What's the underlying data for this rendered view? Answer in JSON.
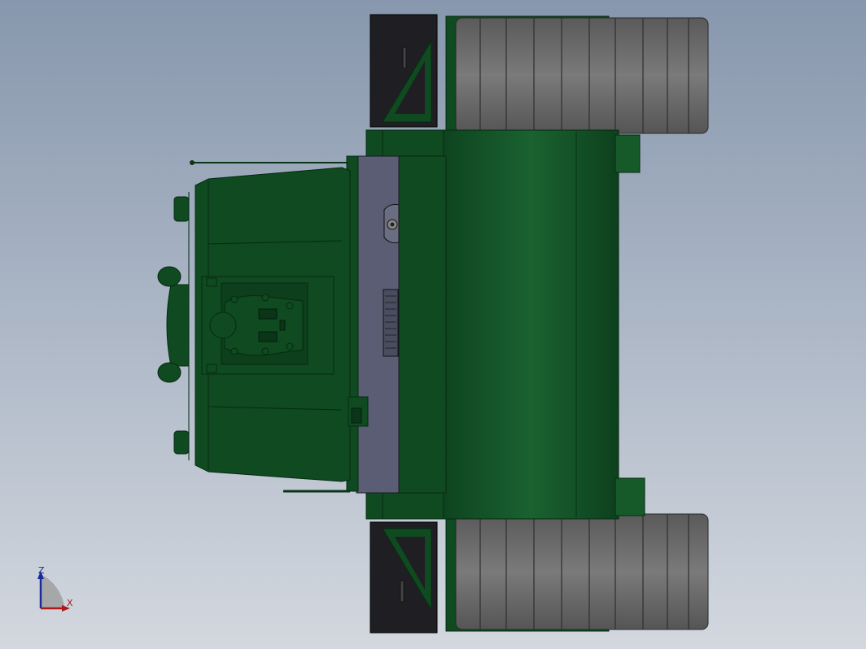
{
  "viewport": {
    "background_top": "#8797ad",
    "background_bottom": "#d3d8df"
  },
  "model": {
    "body_color": "#0f4a20",
    "body_highlight": "#1d6a30",
    "edge_color": "#062a12",
    "plate_color": "#5a5d73",
    "track_color": "#6b6b6b",
    "track_dark": "#4a4a4a",
    "bracket_color": "#1f1f23"
  },
  "triad": {
    "z_label": "Z",
    "x_label": "X",
    "z_color": "#1a2a9a",
    "x_color": "#b01818"
  }
}
